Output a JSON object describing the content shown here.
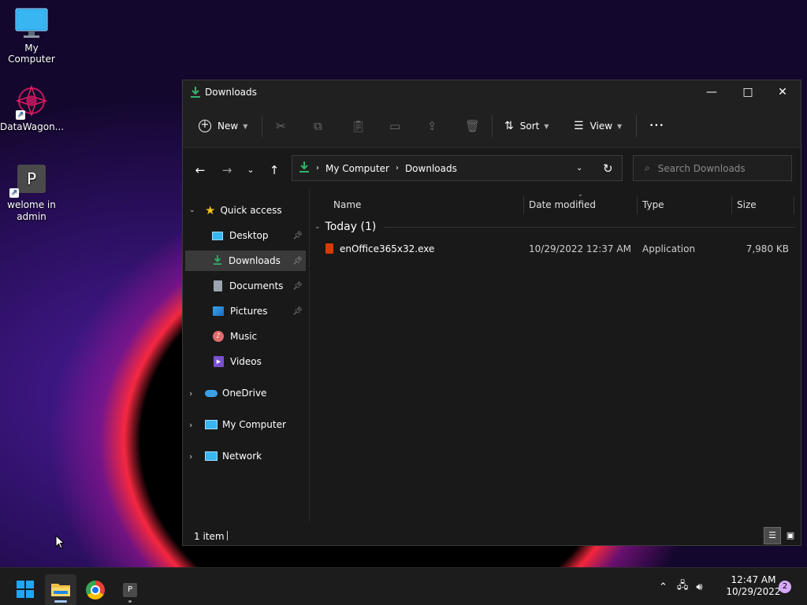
{
  "desktop": {
    "icons": [
      {
        "label": "My Computer"
      },
      {
        "label": "DataWagon..."
      },
      {
        "label": "welome in admin",
        "glyph": "P"
      }
    ]
  },
  "window": {
    "title": "Downloads",
    "controls": {
      "minimize": "—",
      "maximize": "□",
      "close": "✕"
    }
  },
  "toolbar": {
    "new_label": "New",
    "sort_label": "Sort",
    "view_label": "View",
    "more_label": "•••"
  },
  "address": {
    "crumbs": [
      "My Computer",
      "Downloads"
    ],
    "search_placeholder": "Search Downloads"
  },
  "navpane": {
    "quick_access": "Quick access",
    "pinned": [
      {
        "label": "Desktop",
        "icon": "desktop-icon"
      },
      {
        "label": "Downloads",
        "icon": "download-icon"
      },
      {
        "label": "Documents",
        "icon": "documents-icon"
      },
      {
        "label": "Pictures",
        "icon": "pictures-icon"
      },
      {
        "label": "Music",
        "icon": "music-icon"
      },
      {
        "label": "Videos",
        "icon": "videos-icon"
      }
    ],
    "roots": [
      {
        "label": "OneDrive"
      },
      {
        "label": "My Computer"
      },
      {
        "label": "Network"
      }
    ]
  },
  "content": {
    "columns": [
      "Name",
      "Date modified",
      "Type",
      "Size"
    ],
    "group_label": "Today (1)",
    "files": [
      {
        "name": "enOffice365x32.exe",
        "date": "10/29/2022 12:37 AM",
        "type": "Application",
        "size": "7,980 KB"
      }
    ]
  },
  "status": {
    "item_count": "1 item"
  },
  "taskbar": {
    "pinned_glyph": "P",
    "time": "12:47 AM",
    "date": "10/29/2022",
    "notification_count": "2"
  },
  "colors": {
    "accent": "#4cc2ff",
    "selected_row": "#3a3a3a",
    "download_green": "#2fb36b"
  }
}
